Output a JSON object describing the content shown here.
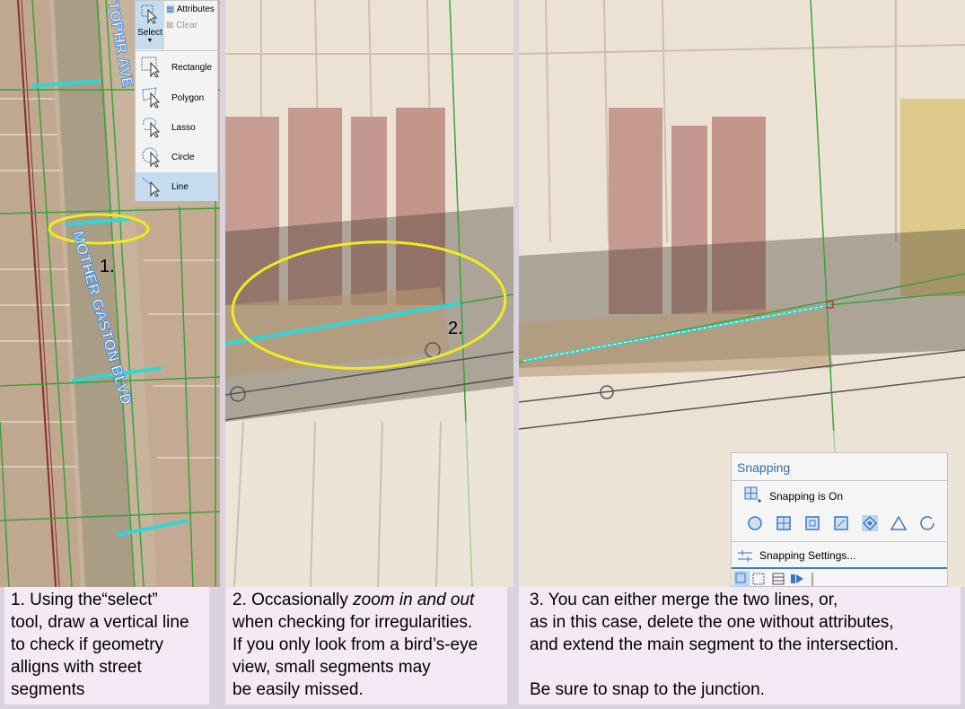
{
  "panel1": {
    "street_top": "TOPHR AVE",
    "street_main": "MOTHER GASTON BLVD",
    "marker": "1.",
    "select_menu": {
      "select_label": "Select",
      "attributes_label": "Attributes",
      "clear_label": "Clear",
      "options": [
        "Rectangle",
        "Polygon",
        "Lasso",
        "Circle",
        "Line"
      ],
      "active_option": "Line"
    }
  },
  "panel2": {
    "marker": "2."
  },
  "panel3": {
    "snapping": {
      "title": "Snapping",
      "status": "Snapping is On",
      "settings_label": "Snapping Settings..."
    }
  },
  "captions": {
    "c1": [
      "1. Using the“select”",
      "tool, draw a vertical line",
      "to check if geometry",
      "alligns with street",
      "segments"
    ],
    "c2_line1_prefix": "2. Occasionally ",
    "c2_line1_italic": "zoom in and out",
    "c2_rest": [
      "when checking for irregularities.",
      "If you only look from a bird’s-eye",
      "view, small segments may",
      "be easily missed."
    ],
    "c3": [
      "3. You can either merge the two lines, or,",
      "as in this case, delete the one without attributes,",
      "and extend the main segment to the intersection.",
      "",
      "Be sure to snap to the junction."
    ]
  },
  "colors": {
    "highlight_cyan": "#2fd6d6",
    "ellipse_yellow": "#f2ea1c",
    "street_green": "#3aa23a",
    "caption_bg": "#f4e9f5",
    "selection_blue": "#c5dcef"
  }
}
